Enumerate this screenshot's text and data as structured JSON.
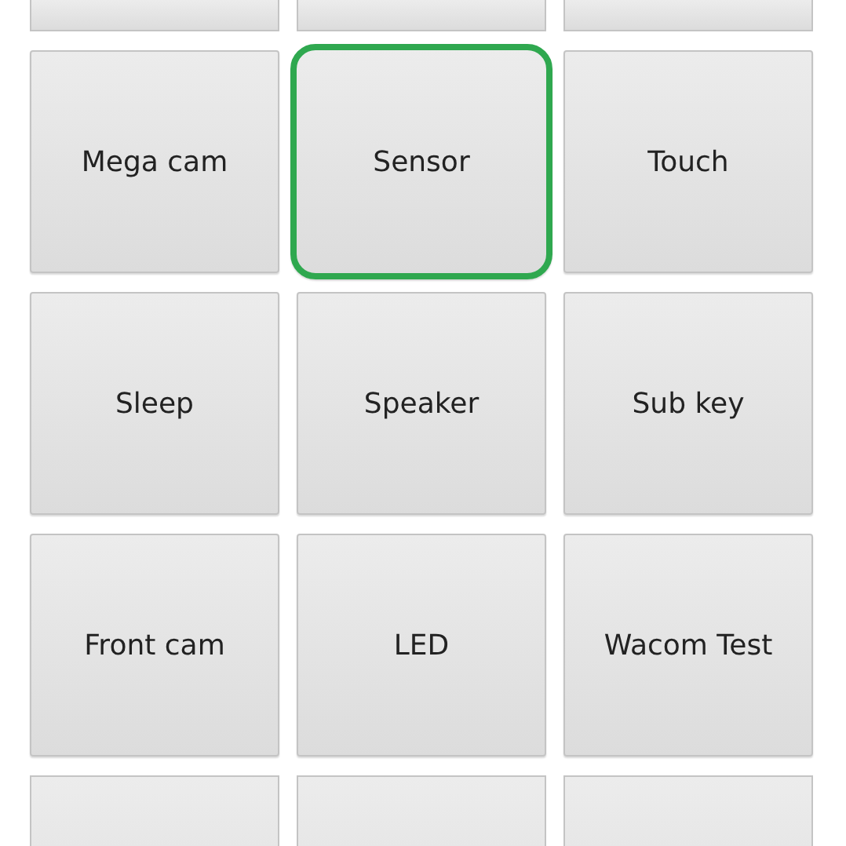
{
  "grid": {
    "rows": [
      [
        {
          "label": "Mega cam",
          "highlighted": false
        },
        {
          "label": "Sensor",
          "highlighted": true
        },
        {
          "label": "Touch",
          "highlighted": false
        }
      ],
      [
        {
          "label": "Sleep",
          "highlighted": false
        },
        {
          "label": "Speaker",
          "highlighted": false
        },
        {
          "label": "Sub key",
          "highlighted": false
        }
      ],
      [
        {
          "label": "Front cam",
          "highlighted": false
        },
        {
          "label": "LED",
          "highlighted": false
        },
        {
          "label": "Wacom Test",
          "highlighted": false
        }
      ]
    ]
  }
}
